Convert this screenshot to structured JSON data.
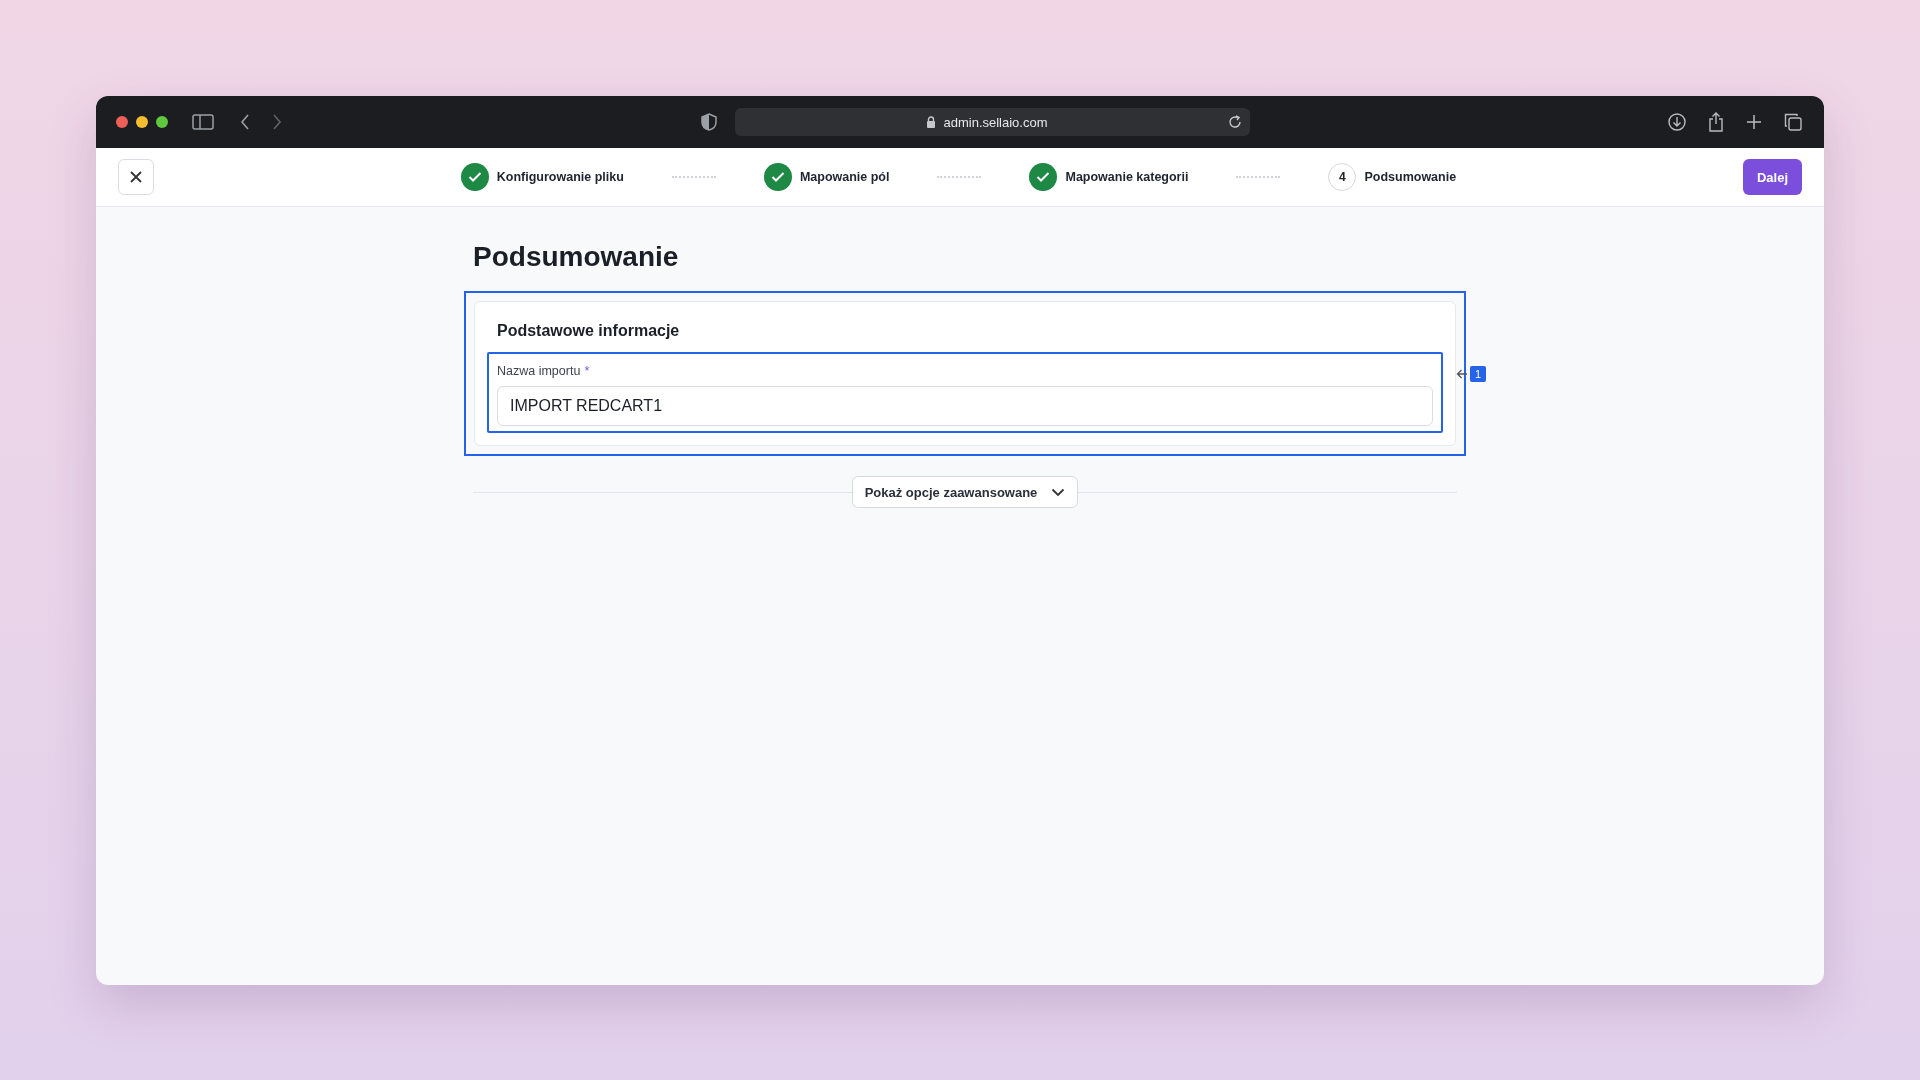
{
  "browser": {
    "url": "admin.sellaio.com"
  },
  "steps": [
    {
      "label": "Konfigurowanie pliku",
      "done": true
    },
    {
      "label": "Mapowanie pól",
      "done": true
    },
    {
      "label": "Mapowanie kategorii",
      "done": true
    },
    {
      "label": "Podsumowanie",
      "number": "4",
      "done": false
    }
  ],
  "next_button": "Dalej",
  "page_title": "Podsumowanie",
  "section": {
    "title": "Podstawowe informacje",
    "highlighted": true,
    "field": {
      "label": "Nazwa importu",
      "required_mark": "*",
      "value": "IMPORT REDCART1",
      "highlighted": true
    }
  },
  "annotation": {
    "number": "1"
  },
  "advanced_button": "Pokaż opcje zaawansowane"
}
